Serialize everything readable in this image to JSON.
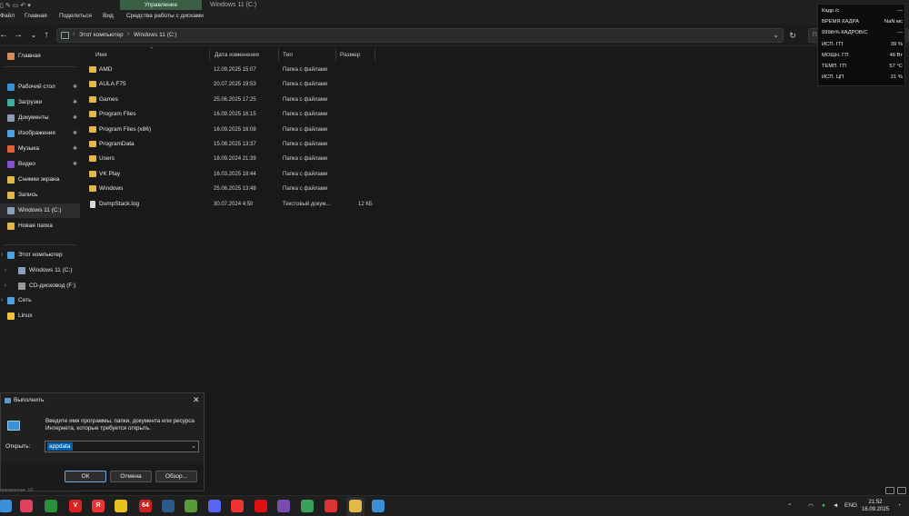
{
  "window": {
    "title": "Windows 11 (C:)",
    "context_tab": "Управление"
  },
  "menu": [
    "Файл",
    "Главная",
    "Поделиться",
    "Вид",
    "Средства работы с дисками"
  ],
  "address": {
    "crumbs": [
      "Этот компьютер",
      "Windows 11 (C:)"
    ],
    "search_placeholder": "Пои"
  },
  "sidebar": {
    "home": "Главная",
    "quick": [
      {
        "label": "Рабочий стол",
        "icon": "desktop-icon",
        "color": "#3b8fd6"
      },
      {
        "label": "Загрузки",
        "icon": "downloads-icon",
        "color": "#3bb0a0"
      },
      {
        "label": "Документы",
        "icon": "documents-icon",
        "color": "#8a9bb3"
      },
      {
        "label": "Изображения",
        "icon": "pictures-icon",
        "color": "#4aa3e0"
      },
      {
        "label": "Музыка",
        "icon": "music-icon",
        "color": "#e0603c"
      },
      {
        "label": "Видео",
        "icon": "videos-icon",
        "color": "#8a4fd0"
      },
      {
        "label": "Снимки экрана",
        "icon": "folder-icon",
        "color": "#e3b74a"
      },
      {
        "label": "Запись",
        "icon": "folder-icon",
        "color": "#e3b74a"
      },
      {
        "label": "Windows 11 (C:)",
        "icon": "drive-icon",
        "color": "#8aa0b8"
      },
      {
        "label": "Новая папка",
        "icon": "folder-icon",
        "color": "#e3b74a"
      }
    ],
    "tree": [
      {
        "label": "Этот компьютер",
        "icon": "this-pc-icon",
        "color": "#4aa3e0"
      },
      {
        "label": "Windows 11 (C:)",
        "icon": "drive-icon",
        "color": "#8aa0b8"
      },
      {
        "label": "CD-дисковод (F:)",
        "icon": "cd-drive-icon",
        "color": "#9a9a9a"
      },
      {
        "label": "Сеть",
        "icon": "network-icon",
        "color": "#4aa3e0"
      },
      {
        "label": "Linux",
        "icon": "linux-icon",
        "color": "#f0c040"
      }
    ]
  },
  "columns": {
    "name": "Имя",
    "date": "Дата изменения",
    "type": "Тип",
    "size": "Размер"
  },
  "files": [
    {
      "name": "AMD",
      "date": "12.09.2025 15:07",
      "type": "Папка с файлами",
      "size": "",
      "kind": "folder"
    },
    {
      "name": "AULA F75",
      "date": "20.07.2025 19:53",
      "type": "Папка с файлами",
      "size": "",
      "kind": "folder"
    },
    {
      "name": "Games",
      "date": "25.06.2025 17:25",
      "type": "Папка с файлами",
      "size": "",
      "kind": "folder"
    },
    {
      "name": "Program Files",
      "date": "16.09.2025 16:15",
      "type": "Папка с файлами",
      "size": "",
      "kind": "folder"
    },
    {
      "name": "Program Files (x86)",
      "date": "16.09.2025 16:08",
      "type": "Папка с файлами",
      "size": "",
      "kind": "folder"
    },
    {
      "name": "ProgramData",
      "date": "15.08.2025 13:37",
      "type": "Папка с файлами",
      "size": "",
      "kind": "folder"
    },
    {
      "name": "Users",
      "date": "18.09.2024 21:39",
      "type": "Папка с файлами",
      "size": "",
      "kind": "folder"
    },
    {
      "name": "VK Play",
      "date": "16.03.2025 18:44",
      "type": "Папка с файлами",
      "size": "",
      "kind": "folder"
    },
    {
      "name": "Windows",
      "date": "25.06.2025 13:48",
      "type": "Папка с файлами",
      "size": "",
      "kind": "folder"
    },
    {
      "name": "DumpStack.log",
      "date": "30.07.2024 4:50",
      "type": "Текстовый докум...",
      "size": "12 КБ",
      "kind": "document"
    }
  ],
  "overlay": {
    "rows": [
      {
        "k": "Кадр./с",
        "v": "—"
      },
      {
        "k": "ВРЕМЯ КАДРА",
        "v": "NaN мс"
      },
      {
        "k": "999th% КАДРОВ/С",
        "v": "—"
      },
      {
        "k": "ИСП. ГП",
        "v": "39 %"
      },
      {
        "k": "МОЩН. ГП",
        "v": "46 Вт"
      },
      {
        "k": "ТЕМП. ГП",
        "v": "57 °C"
      },
      {
        "k": "ИСП. ЦП",
        "v": "21 %"
      }
    ]
  },
  "dialog": {
    "title": "Выполнить",
    "description": "Введите имя программы, папки, документа или ресурса Интернета, которые требуется открыть.",
    "open_label": "Открыть:",
    "input_value": "appdata",
    "ok": "ОК",
    "cancel": "Отмена",
    "browse": "Обзор..."
  },
  "status": {
    "text": "элементов: 10"
  },
  "taskbar": {
    "apps": [
      {
        "icon": "start-icon",
        "glyph": "",
        "color": "#3b8fd6"
      },
      {
        "icon": "app-icon",
        "glyph": "",
        "color": "#e04060"
      },
      {
        "icon": "app-icon",
        "glyph": "",
        "color": "#2a8f3a"
      },
      {
        "icon": "app-icon",
        "glyph": "V",
        "color": "#d22"
      },
      {
        "icon": "yandex-icon",
        "glyph": "Я",
        "color": "#e33"
      },
      {
        "icon": "app-icon",
        "glyph": "",
        "color": "#e8c020"
      },
      {
        "icon": "app-icon",
        "glyph": "64",
        "color": "#c22"
      },
      {
        "icon": "steam-icon",
        "glyph": "",
        "color": "#2a5a8a"
      },
      {
        "icon": "app-icon",
        "glyph": "",
        "color": "#5a9a3a"
      },
      {
        "icon": "discord-icon",
        "glyph": "",
        "color": "#5865f2"
      },
      {
        "icon": "yandex-browser-icon",
        "glyph": "",
        "color": "#e33"
      },
      {
        "icon": "opera-icon",
        "glyph": "",
        "color": "#d11"
      },
      {
        "icon": "app-icon",
        "glyph": "",
        "color": "#7a4ab0"
      },
      {
        "icon": "app-icon",
        "glyph": "",
        "color": "#3aa05a"
      },
      {
        "icon": "app-icon",
        "glyph": "",
        "color": "#d33"
      },
      {
        "icon": "file-explorer-icon",
        "glyph": "",
        "color": "#e3b74a"
      },
      {
        "icon": "run-icon",
        "glyph": "",
        "color": "#3b8fd6"
      }
    ],
    "lang": "ENG",
    "time": "21:52",
    "date": "16.09.2025"
  }
}
